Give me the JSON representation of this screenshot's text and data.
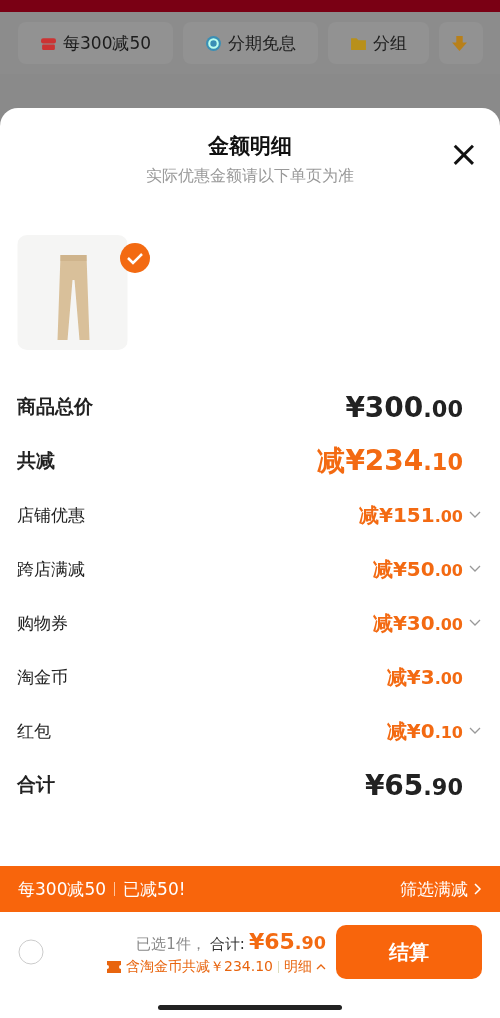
{
  "chips": [
    {
      "label": "每300减50"
    },
    {
      "label": "分期免息"
    },
    {
      "label": "分组"
    }
  ],
  "sheet": {
    "title": "金额明细",
    "subtitle": "实际优惠金额请以下单页为准",
    "close": "×"
  },
  "product": {
    "checked": true
  },
  "rows": [
    {
      "kind": "major",
      "label": "商品总价",
      "amount": "¥300.00",
      "discount": false,
      "expandable": false
    },
    {
      "kind": "major",
      "label": "共减",
      "amount": "减¥234.10",
      "discount": true,
      "expandable": false
    },
    {
      "kind": "minor",
      "label": "店铺优惠",
      "amount": "减¥151.00",
      "discount": true,
      "expandable": true
    },
    {
      "kind": "minor",
      "label": "跨店满减",
      "amount": "减¥50.00",
      "discount": true,
      "expandable": true
    },
    {
      "kind": "minor",
      "label": "购物券",
      "amount": "减¥30.00",
      "discount": true,
      "expandable": true
    },
    {
      "kind": "minor",
      "label": "淘金币",
      "amount": "减¥3.00",
      "discount": true,
      "expandable": false
    },
    {
      "kind": "minor",
      "label": "红包",
      "amount": "减¥0.10",
      "discount": true,
      "expandable": true
    },
    {
      "kind": "major",
      "label": "合计",
      "amount": "¥65.90",
      "discount": false,
      "expandable": false
    }
  ],
  "promo_bar": {
    "rule": "每300减50",
    "status": "已减50!",
    "link": "筛选满减"
  },
  "footer": {
    "select_all_checked": false,
    "selected_count": "已选1件，",
    "total_label": "合计:",
    "total": "¥65.90",
    "savings": "含淘金币共减￥234.10",
    "details": "明细",
    "checkout": "结算"
  }
}
